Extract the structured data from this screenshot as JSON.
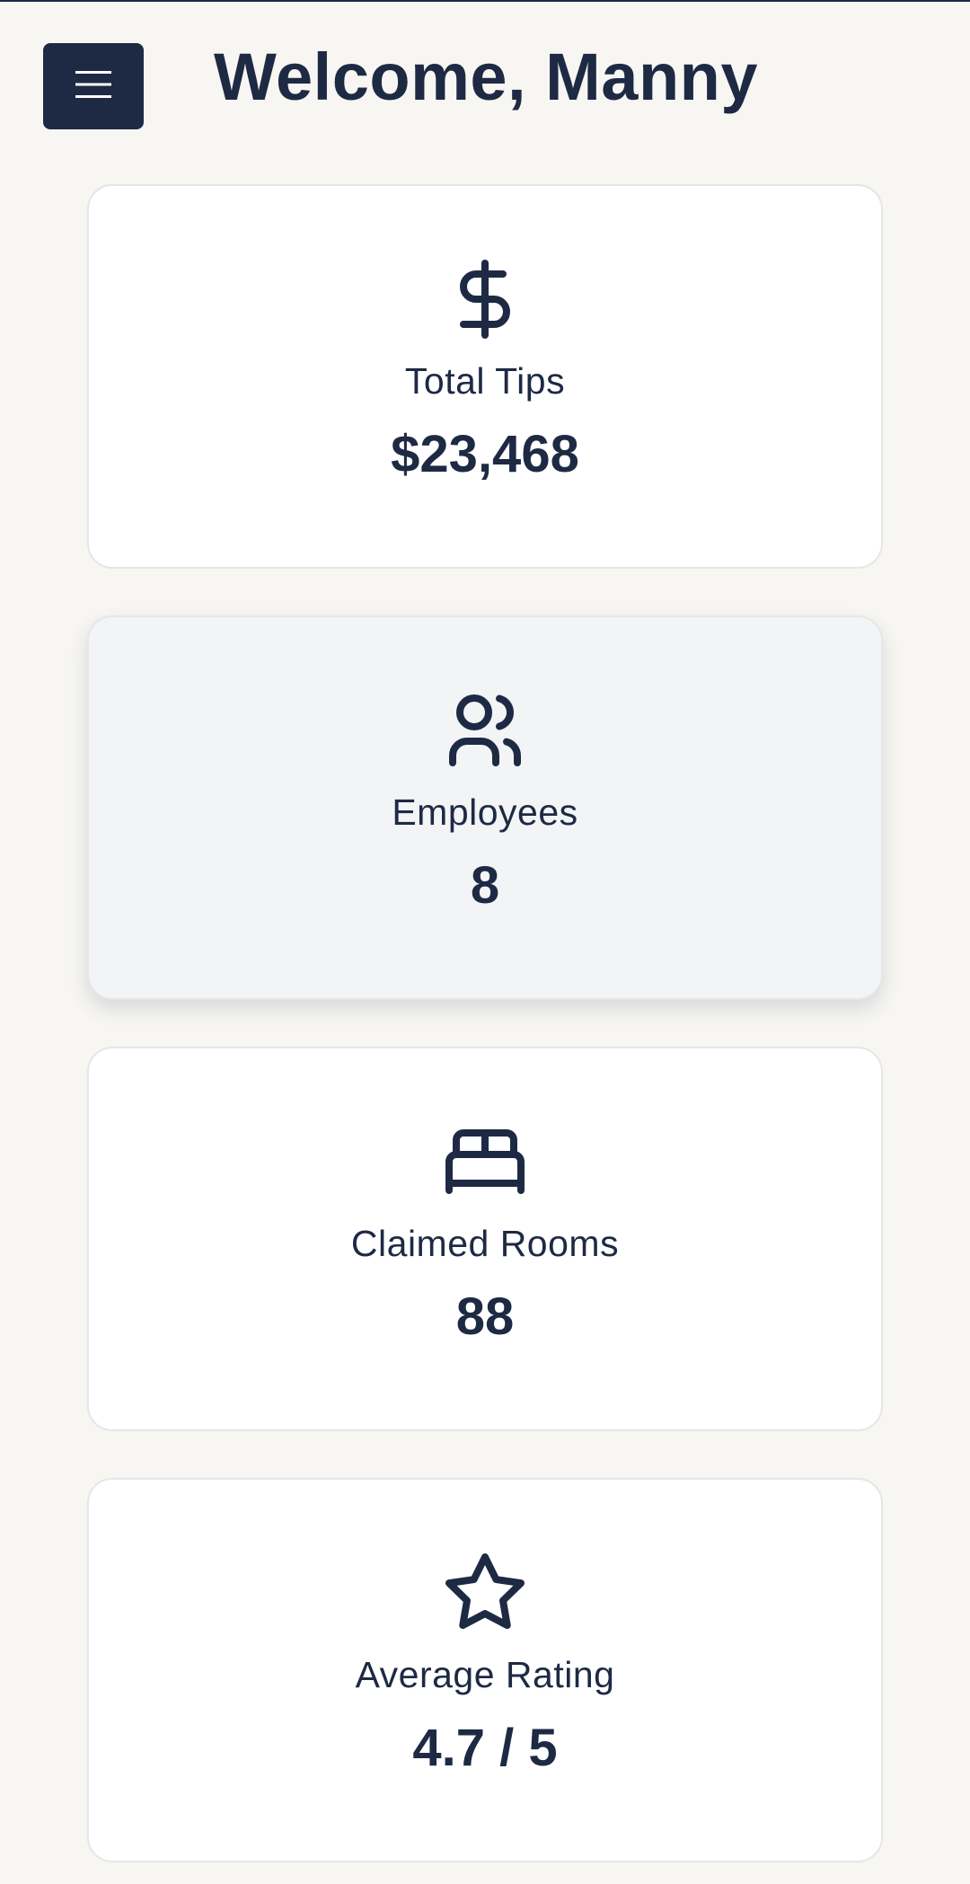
{
  "header": {
    "title": "Welcome, Manny",
    "menu_icon": "hamburger-menu-icon"
  },
  "stats": [
    {
      "icon": "dollar-icon",
      "label": "Total Tips",
      "value": "$23,468"
    },
    {
      "icon": "users-icon",
      "label": "Employees",
      "value": "8"
    },
    {
      "icon": "bed-icon",
      "label": "Claimed Rooms",
      "value": "88"
    },
    {
      "icon": "star-icon",
      "label": "Average Rating",
      "value": "4.7 / 5"
    }
  ],
  "colors": {
    "primary": "#1e2a44",
    "background": "#f7f6f2",
    "card": "#ffffff",
    "card_hover": "#f2f4f6"
  }
}
